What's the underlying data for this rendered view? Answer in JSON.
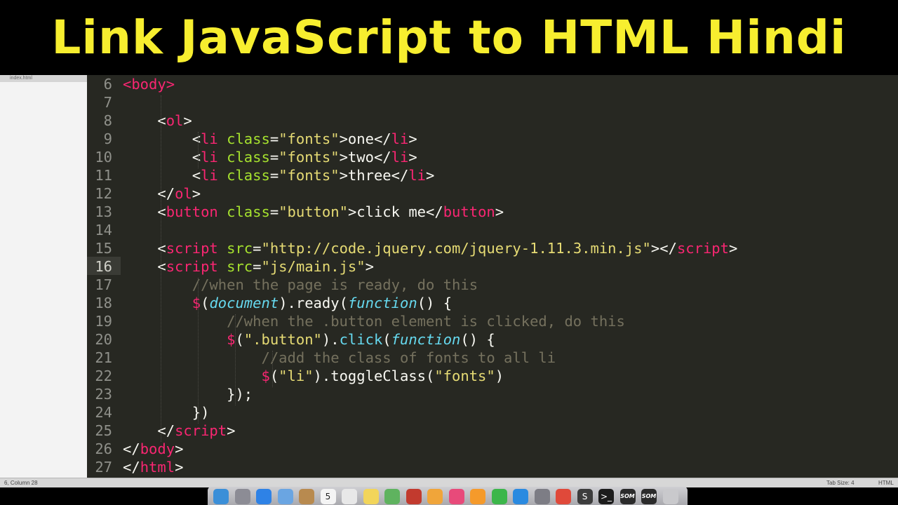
{
  "banner": {
    "title": "Link JavaScript to HTML Hindi"
  },
  "sidebar": {
    "open_file": "index.html"
  },
  "editor": {
    "lines": [
      {
        "num": "6",
        "tokens": [
          [
            "t",
            "<"
          ],
          [
            "t",
            "body"
          ],
          [
            "t",
            ">"
          ]
        ]
      },
      {
        "num": "7",
        "tokens": []
      },
      {
        "num": "8",
        "tokens": [
          [
            "p",
            "    "
          ],
          [
            "p",
            "<"
          ],
          [
            "t",
            "ol"
          ],
          [
            "p",
            ">"
          ]
        ]
      },
      {
        "num": "9",
        "tokens": [
          [
            "p",
            "        "
          ],
          [
            "p",
            "<"
          ],
          [
            "t",
            "li"
          ],
          [
            "p",
            " "
          ],
          [
            "a",
            "class"
          ],
          [
            "p",
            "="
          ],
          [
            "s",
            "\"fonts\""
          ],
          [
            "p",
            ">one</"
          ],
          [
            "t",
            "li"
          ],
          [
            "p",
            ">"
          ]
        ]
      },
      {
        "num": "10",
        "tokens": [
          [
            "p",
            "        "
          ],
          [
            "p",
            "<"
          ],
          [
            "t",
            "li"
          ],
          [
            "p",
            " "
          ],
          [
            "a",
            "class"
          ],
          [
            "p",
            "="
          ],
          [
            "s",
            "\"fonts\""
          ],
          [
            "p",
            ">two</"
          ],
          [
            "t",
            "li"
          ],
          [
            "p",
            ">"
          ]
        ]
      },
      {
        "num": "11",
        "tokens": [
          [
            "p",
            "        "
          ],
          [
            "p",
            "<"
          ],
          [
            "t",
            "li"
          ],
          [
            "p",
            " "
          ],
          [
            "a",
            "class"
          ],
          [
            "p",
            "="
          ],
          [
            "s",
            "\"fonts\""
          ],
          [
            "p",
            ">three</"
          ],
          [
            "t",
            "li"
          ],
          [
            "p",
            ">"
          ]
        ]
      },
      {
        "num": "12",
        "tokens": [
          [
            "p",
            "    "
          ],
          [
            "p",
            "</"
          ],
          [
            "t",
            "ol"
          ],
          [
            "p",
            ">"
          ]
        ]
      },
      {
        "num": "13",
        "tokens": [
          [
            "p",
            "    "
          ],
          [
            "p",
            "<"
          ],
          [
            "t",
            "button"
          ],
          [
            "p",
            " "
          ],
          [
            "a",
            "class"
          ],
          [
            "p",
            "="
          ],
          [
            "s",
            "\"button\""
          ],
          [
            "p",
            ">click me</"
          ],
          [
            "t",
            "button"
          ],
          [
            "p",
            ">"
          ]
        ]
      },
      {
        "num": "14",
        "tokens": []
      },
      {
        "num": "15",
        "tokens": [
          [
            "p",
            "    "
          ],
          [
            "p",
            "<"
          ],
          [
            "t",
            "script"
          ],
          [
            "p",
            " "
          ],
          [
            "a",
            "src"
          ],
          [
            "p",
            "="
          ],
          [
            "s",
            "\"http://code.jquery.com/jquery-1.11.3.min.js\""
          ],
          [
            "p",
            "></"
          ],
          [
            "t",
            "script"
          ],
          [
            "p",
            ">"
          ]
        ]
      },
      {
        "num": "16",
        "tokens": [
          [
            "p",
            "    "
          ],
          [
            "p",
            "<"
          ],
          [
            "t",
            "script"
          ],
          [
            "p",
            " "
          ],
          [
            "a",
            "src"
          ],
          [
            "p",
            "="
          ],
          [
            "s",
            "\"js/main.js\""
          ],
          [
            "p",
            ">"
          ]
        ]
      },
      {
        "num": "17",
        "tokens": [
          [
            "p",
            "        "
          ],
          [
            "c",
            "//when the page is ready, do this"
          ]
        ]
      },
      {
        "num": "18",
        "tokens": [
          [
            "p",
            "        "
          ],
          [
            "t",
            "$"
          ],
          [
            "p",
            "("
          ],
          [
            "i",
            "document"
          ],
          [
            "p",
            ")."
          ],
          [
            "p",
            "ready"
          ],
          [
            "p",
            "("
          ],
          [
            "i",
            "function"
          ],
          [
            "p",
            "() {"
          ]
        ]
      },
      {
        "num": "19",
        "tokens": [
          [
            "p",
            "            "
          ],
          [
            "c",
            "//when the .button element is clicked, do this"
          ]
        ]
      },
      {
        "num": "20",
        "tokens": [
          [
            "p",
            "            "
          ],
          [
            "t",
            "$"
          ],
          [
            "p",
            "("
          ],
          [
            "s",
            "\".button\""
          ],
          [
            "p",
            ")."
          ],
          [
            "f",
            "click"
          ],
          [
            "p",
            "("
          ],
          [
            "i",
            "function"
          ],
          [
            "p",
            "() {"
          ]
        ]
      },
      {
        "num": "21",
        "tokens": [
          [
            "p",
            "                "
          ],
          [
            "c",
            "//add the class of fonts to all li"
          ]
        ]
      },
      {
        "num": "22",
        "tokens": [
          [
            "p",
            "                "
          ],
          [
            "t",
            "$"
          ],
          [
            "p",
            "("
          ],
          [
            "s",
            "\"li\""
          ],
          [
            "p",
            ").toggleClass("
          ],
          [
            "s",
            "\"fonts\""
          ],
          [
            "p",
            ")"
          ]
        ]
      },
      {
        "num": "23",
        "tokens": [
          [
            "p",
            "            "
          ],
          [
            "p",
            "});"
          ]
        ]
      },
      {
        "num": "24",
        "tokens": [
          [
            "p",
            "        "
          ],
          [
            "p",
            "})"
          ]
        ]
      },
      {
        "num": "25",
        "tokens": [
          [
            "p",
            "    "
          ],
          [
            "p",
            "</"
          ],
          [
            "t",
            "script"
          ],
          [
            "p",
            ">"
          ]
        ]
      },
      {
        "num": "26",
        "tokens": [
          [
            "p",
            "</"
          ],
          [
            "t",
            "body"
          ],
          [
            "p",
            ">"
          ]
        ]
      },
      {
        "num": "27",
        "tokens": [
          [
            "p",
            "</"
          ],
          [
            "t",
            "html"
          ],
          [
            "p",
            ">"
          ]
        ]
      }
    ],
    "current_line": "16"
  },
  "status": {
    "position": "6, Column 28",
    "tab_size": "Tab Size: 4",
    "syntax": "HTML"
  },
  "dock": {
    "apps": [
      {
        "name": "finder-icon",
        "glyph": "",
        "color": "#3b8fd8"
      },
      {
        "name": "launchpad-icon",
        "glyph": "",
        "color": "#8c8c95"
      },
      {
        "name": "safari-icon",
        "glyph": "",
        "color": "#2e82e6"
      },
      {
        "name": "mail-icon",
        "glyph": "",
        "color": "#6aa5e2"
      },
      {
        "name": "contacts-icon",
        "glyph": "",
        "color": "#b88a4f"
      },
      {
        "name": "calendar-icon",
        "glyph": "5",
        "color": "#f4f4f4"
      },
      {
        "name": "reminders-icon",
        "glyph": "",
        "color": "#e8e8e8"
      },
      {
        "name": "notes-icon",
        "glyph": "",
        "color": "#f2d55a"
      },
      {
        "name": "maps-icon",
        "glyph": "",
        "color": "#5fb35f"
      },
      {
        "name": "photo-booth-icon",
        "glyph": "",
        "color": "#c23a2e"
      },
      {
        "name": "photos-icon",
        "glyph": "",
        "color": "#f0a53a"
      },
      {
        "name": "itunes-icon",
        "glyph": "",
        "color": "#e84a7a"
      },
      {
        "name": "ibooks-icon",
        "glyph": "",
        "color": "#f59a2b"
      },
      {
        "name": "facetime-icon",
        "glyph": "",
        "color": "#3cb64a"
      },
      {
        "name": "app-store-icon",
        "glyph": "",
        "color": "#2a8ae0"
      },
      {
        "name": "system-preferences-icon",
        "glyph": "",
        "color": "#7d7d85"
      },
      {
        "name": "chrome-icon",
        "glyph": "",
        "color": "#e0493a"
      },
      {
        "name": "sublime-text-icon",
        "glyph": "S",
        "color": "#3d3d3d"
      },
      {
        "name": "terminal-icon",
        "glyph": ">_",
        "color": "#1c1c1c"
      },
      {
        "name": "som-app-icon",
        "glyph": "SOM",
        "color": "#2b2b2b"
      },
      {
        "name": "som-app-2-icon",
        "glyph": "SOM",
        "color": "#2b2b2b"
      },
      {
        "name": "trash-icon",
        "glyph": "",
        "color": "#c9c9cc"
      }
    ]
  }
}
